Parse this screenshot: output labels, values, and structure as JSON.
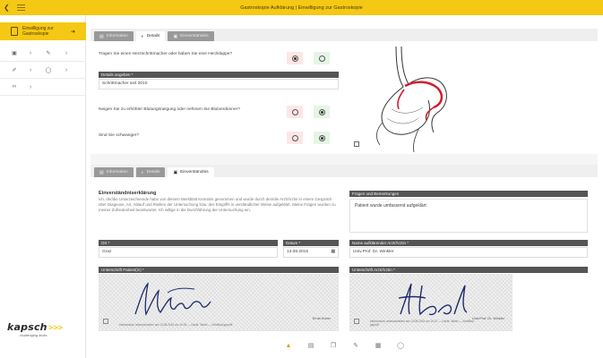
{
  "header": {
    "title": "Gastroskopie Aufklärung | Einwilligung zur Gastroskopie",
    "back_icon": "chevron-left-icon",
    "menu_icon": "menu-icon"
  },
  "sidebar": {
    "active_item": "Einwilligung zur Gastroskopie",
    "logo_brand": "kapsch",
    "logo_tag": "challenging limits"
  },
  "top_tabs": [
    {
      "label": "Information",
      "state": "inactive"
    },
    {
      "label": "Details",
      "state": "active"
    },
    {
      "label": "Einverständnis",
      "state": "inactive"
    }
  ],
  "questions": [
    {
      "text": "Tragen Sie einen Herzschrittmacher oder haben Sie eine Herzklappe?",
      "selected": "no"
    },
    {
      "text": "Neigen Sie zu erhöhter Blutungsneigung oder nehmen Sie Blutverdünner?",
      "selected": "yes"
    },
    {
      "text": "Sind Sie schwanger?",
      "selected": "yes"
    }
  ],
  "details_field": {
    "label": "Details angeben *",
    "value": "Schrittmacher seit 2010"
  },
  "bottom_tabs": [
    {
      "label": "Information",
      "state": "inactive"
    },
    {
      "label": "Details",
      "state": "inactive"
    },
    {
      "label": "Einverständnis",
      "state": "active"
    }
  ],
  "consent": {
    "title": "Einverständniserklärung",
    "text": "Ich, der/die Unterzeichnende habe von diesem Merkblatt Kenntnis genommen und wurde durch den/die Arzt/Ärztin in einem Gespräch über Diagnose, Art, Ablauf und Risiken der Untersuchung bzw. des Eingriffs in verständlicher Weise aufgeklärt. Meine Fragen wurden zu meiner Zufriedenheit beantwortet. Ich willige in die Durchführung der Untersuchung ein."
  },
  "remarks": {
    "label": "Fragen und Bemerkungen",
    "value": "Patient wurde umfassend aufgeklärt"
  },
  "place": {
    "label": "Ort *",
    "value": "Graz"
  },
  "date": {
    "label": "Datum *",
    "value": "13.08.2015"
  },
  "doctor": {
    "label": "Name aufklärender Arzt/Ärztin *",
    "value": "Univ.Prof. Dr. Winkler"
  },
  "patient_signature": {
    "label": "Unterschrift Patient(in) *",
    "name": "Ernst Huber",
    "fine_print": "elektronisch unterschrieben am 13.08.2015 um 10:05 — Gerät: Tablet — Zertifikat geprüft"
  },
  "doctor_signature": {
    "label": "Unterschrift Arzt/Ärztin *",
    "name": "Univ.Prof. Dr. Winkler",
    "fine_print": "elektronisch unterschrieben am 13.08.2015 um 10:07 — Gerät: Tablet — Zertifikat geprüft"
  },
  "toolbar": [
    "save-icon",
    "document-icon",
    "copy-icon",
    "sign-icon",
    "print-icon",
    "power-icon"
  ]
}
